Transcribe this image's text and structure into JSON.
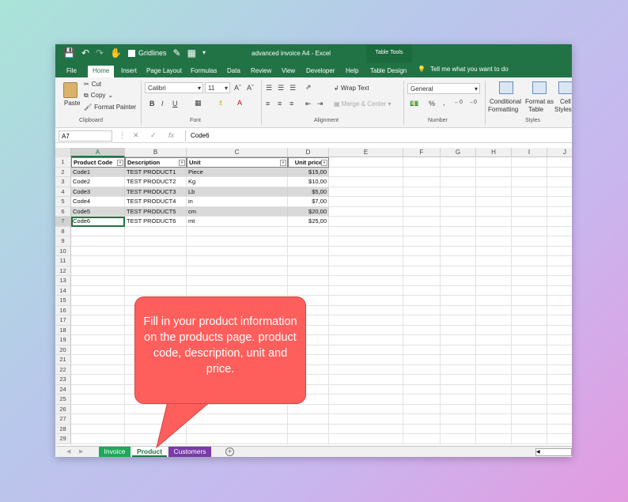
{
  "window": {
    "title": "advanced invoice A4  -  Excel"
  },
  "qat": {
    "gridlines_label": "Gridlines"
  },
  "table_tools": "Table Tools",
  "tabs": [
    {
      "label": "File"
    },
    {
      "label": "Home",
      "active": true
    },
    {
      "label": "Insert"
    },
    {
      "label": "Page Layout"
    },
    {
      "label": "Formulas"
    },
    {
      "label": "Data"
    },
    {
      "label": "Review"
    },
    {
      "label": "View"
    },
    {
      "label": "Developer"
    },
    {
      "label": "Help"
    },
    {
      "label": "Table Design"
    }
  ],
  "tell_me": "Tell me what you want to do",
  "ribbon": {
    "clipboard": {
      "paste": "Paste",
      "cut": "Cut",
      "copy": "Copy",
      "format_painter": "Format Painter",
      "label": "Clipboard"
    },
    "font": {
      "name": "Calibri",
      "size": "11",
      "label": "Font",
      "bold": "B",
      "italic": "I",
      "underline": "U"
    },
    "alignment": {
      "wrap_text": "Wrap Text",
      "merge_center": "Merge & Center",
      "label": "Alignment"
    },
    "number": {
      "format": "General",
      "label": "Number"
    },
    "styles": {
      "conditional": "Conditional",
      "formatting": "Formatting",
      "format_as": "Format as",
      "table": "Table",
      "cell": "Cell",
      "cell_styles": "Styles",
      "label": "Styles"
    }
  },
  "formula_bar": {
    "name_box": "A7",
    "content": "Code6"
  },
  "columns": [
    "A",
    "B",
    "C",
    "D",
    "E",
    "F",
    "G",
    "H",
    "I",
    "J"
  ],
  "table": {
    "headers": [
      "Product Code",
      "Description",
      "Unit",
      "Unit price"
    ],
    "rows": [
      [
        "Code1",
        "TEST PRODUCT1",
        "Piece",
        "$15,00"
      ],
      [
        "Code2",
        "TEST PRODUCT2",
        "Kg",
        "$10,00"
      ],
      [
        "Code3",
        "TEST PRODUCT3",
        "Lb",
        "$5,00"
      ],
      [
        "Code4",
        "TEST PRODUCT4",
        "in",
        "$7,00"
      ],
      [
        "Code5",
        "TEST PRODUCT5",
        "cm",
        "$20,00"
      ],
      [
        "Code6",
        "TEST PRODUCT6",
        "mt",
        "$25,00"
      ]
    ]
  },
  "row_count": 29,
  "sheets": [
    {
      "label": "Invoice",
      "bg": "#1fa85a",
      "fg": "#ffffff"
    },
    {
      "label": "Product",
      "bg": "#ffffff",
      "fg": "#217346",
      "active": true
    },
    {
      "label": "Customers",
      "bg": "#7a3aa8",
      "fg": "#ffffff"
    }
  ],
  "add_sheet": "+",
  "callout": {
    "text": "Fill in your product information on the products page. product code, description, unit and price."
  },
  "colors": {
    "excel_green": "#217346",
    "callout_red": "#ff5f5c"
  }
}
